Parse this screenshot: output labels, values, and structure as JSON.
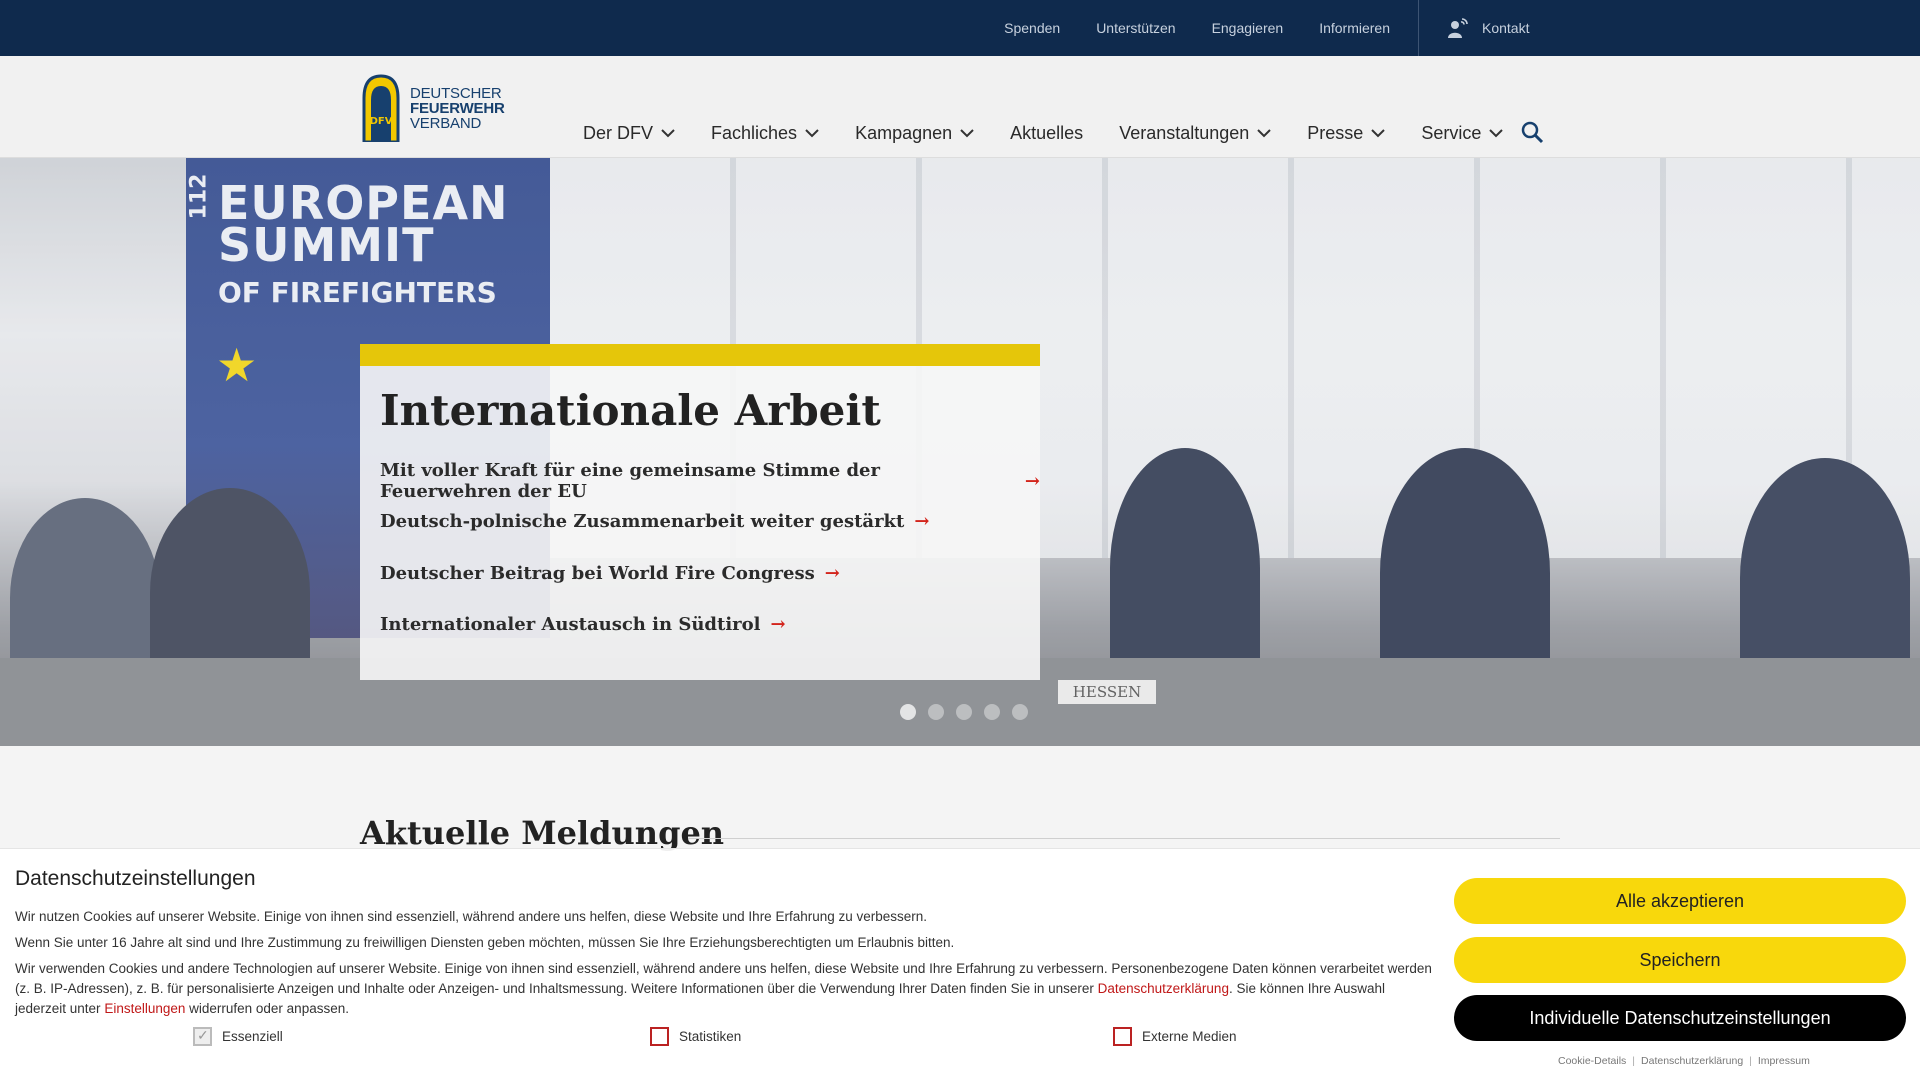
{
  "topbar": {
    "links": [
      "Spenden",
      "Unterstützen",
      "Engagieren",
      "Informieren"
    ],
    "contact_label": "Kontakt"
  },
  "logo": {
    "line1": "DEUTSCHER",
    "line2": "FEUERWEHR",
    "line3": "VERBAND",
    "mark_text": "DFV"
  },
  "nav": {
    "items": [
      {
        "label": "Der DFV",
        "has_dropdown": true
      },
      {
        "label": "Fachliches",
        "has_dropdown": true
      },
      {
        "label": "Kampagnen",
        "has_dropdown": true
      },
      {
        "label": "Aktuelles",
        "has_dropdown": false
      },
      {
        "label": "Veranstaltungen",
        "has_dropdown": true
      },
      {
        "label": "Presse",
        "has_dropdown": true
      },
      {
        "label": "Service",
        "has_dropdown": true
      }
    ]
  },
  "hero": {
    "banner_line1": "EUROPEAN",
    "banner_line2": "SUMMIT",
    "banner_line3": "OF FIREFIGHTERS",
    "banner_badge": "112",
    "table_sign": "HESSEN",
    "title": "Internationale Arbeit",
    "links": [
      "Mit voller Kraft für eine gemeinsame Stimme der Feuerwehren der EU",
      "Deutsch-polnische Zusammenarbeit weiter gestärkt",
      "Deutscher Beitrag bei World Fire Congress",
      "Internationaler Austausch in Südtirol"
    ],
    "slides_count": 5,
    "active_slide": 1
  },
  "section": {
    "title": "Aktuelle Meldungen"
  },
  "cookie": {
    "title": "Datenschutzeinstellungen",
    "p1": "Wir nutzen Cookies auf unserer Website. Einige von ihnen sind essenziell, während andere uns helfen, diese Website und Ihre Erfahrung zu verbessern.",
    "p2": "Wenn Sie unter 16 Jahre alt sind und Ihre Zustimmung zu freiwilligen Diensten geben möchten, müssen Sie Ihre Erziehungsberechtigten um Erlaubnis bitten.",
    "p3_a": "Wir verwenden Cookies und andere Technologien auf unserer Website. Einige von ihnen sind essenziell, während andere uns helfen, diese Website und Ihre Erfahrung zu verbessern. Personenbezogene Daten können verarbeitet werden (z. B. IP-Adressen), z. B. für personalisierte Anzeigen und Inhalte oder Anzeigen- und Inhaltsmessung. Weitere Informationen über die Verwendung Ihrer Daten finden Sie in unserer ",
    "p3_link1": "Datenschutzerklärung",
    "p3_b": ". Sie können Ihre Auswahl jederzeit unter ",
    "p3_link2": "Einstellungen",
    "p3_c": " widerrufen oder anpassen.",
    "checkboxes": [
      {
        "label": "Essenziell",
        "checked": true
      },
      {
        "label": "Statistiken",
        "checked": false
      },
      {
        "label": "Externe Medien",
        "checked": false
      }
    ],
    "btn_accept_all": "Alle akzeptieren",
    "btn_save": "Speichern",
    "btn_individual": "Individuelle Datenschutzeinstellungen",
    "footer_links": [
      "Cookie-Details",
      "Datenschutzerklärung",
      "Impressum"
    ]
  },
  "colors": {
    "topbar": "#0f2a4d",
    "accent_yellow": "#f8d80c",
    "link_red": "#c01818",
    "arrow_red": "#d3241b"
  }
}
